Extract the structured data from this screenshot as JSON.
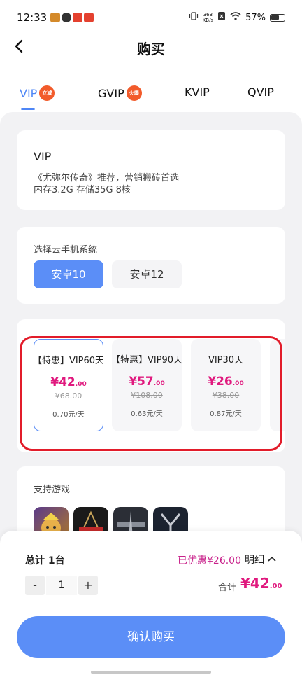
{
  "status_bar": {
    "time": "12:33",
    "net_speed_value": "363",
    "net_speed_unit": "KB/s",
    "battery": "57%"
  },
  "header": {
    "title": "购买"
  },
  "tabs": [
    {
      "label": "VIP",
      "badge": "立减",
      "active": true
    },
    {
      "label": "GVIP",
      "badge": "火爆",
      "active": false
    },
    {
      "label": "KVIP",
      "badge": "",
      "active": false
    },
    {
      "label": "QVIP",
      "badge": "",
      "active": false
    }
  ],
  "vip_info": {
    "title": "VIP",
    "desc_line1": "《尤弥尔传奇》推荐，营销搬砖首选",
    "desc_line2": "内存3.2G  存储35G  8核"
  },
  "system_select": {
    "label": "选择云手机系统",
    "options": [
      {
        "label": "安卓10",
        "selected": true
      },
      {
        "label": "安卓12",
        "selected": false
      }
    ]
  },
  "plans": [
    {
      "name": "【特惠】VIP60天",
      "price_int": "¥42",
      "price_dec": ".00",
      "original": "¥68.00",
      "daily": "0.70元/天",
      "selected": true
    },
    {
      "name": "【特惠】VIP90天",
      "price_int": "¥57",
      "price_dec": ".00",
      "original": "¥108.00",
      "daily": "0.63元/天",
      "selected": false
    },
    {
      "name": "VIP30天",
      "price_int": "¥26",
      "price_dec": ".00",
      "original": "¥38.00",
      "daily": "0.87元/天",
      "selected": false
    }
  ],
  "games": {
    "label": "支持游戏",
    "icons": [
      "clash-of-clans-icon",
      "reborn-game-icon",
      "lineage-game-icon",
      "y-game-icon"
    ]
  },
  "checkout": {
    "total_label": "总计  1台",
    "discount": "已优惠¥26.00",
    "detail_label": "明细",
    "quantity": "1",
    "minus": "-",
    "plus": "+",
    "sum_label": "合计",
    "sum_int": "¥42",
    "sum_dec": ".00",
    "confirm_label": "确认购买"
  },
  "colors": {
    "accent": "#5b8ef7",
    "price": "#e0197e",
    "highlight": "#e21c2a",
    "badge": "#f25b2b"
  }
}
